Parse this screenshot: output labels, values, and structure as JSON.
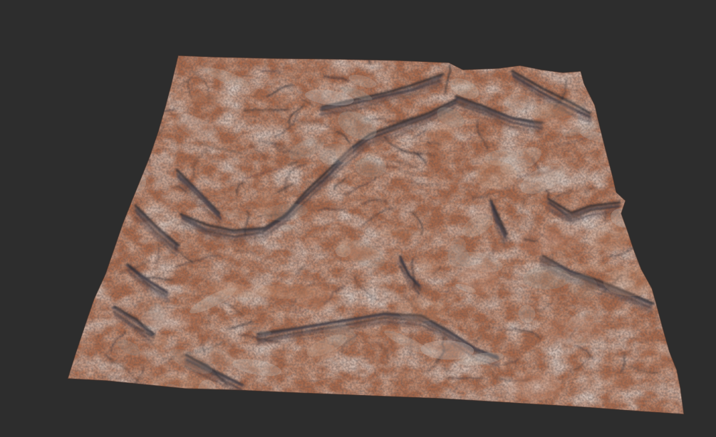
{
  "viewport": {
    "background_color": "#2d2d2d"
  },
  "terrain": {
    "palette": {
      "rust": "#a8684a",
      "rust_light": "#bf8a6e",
      "stone": "#a09890",
      "stone_light": "#c4bdb5",
      "shadow": "#2b2a30",
      "shadow_mid": "#4a4650"
    }
  }
}
